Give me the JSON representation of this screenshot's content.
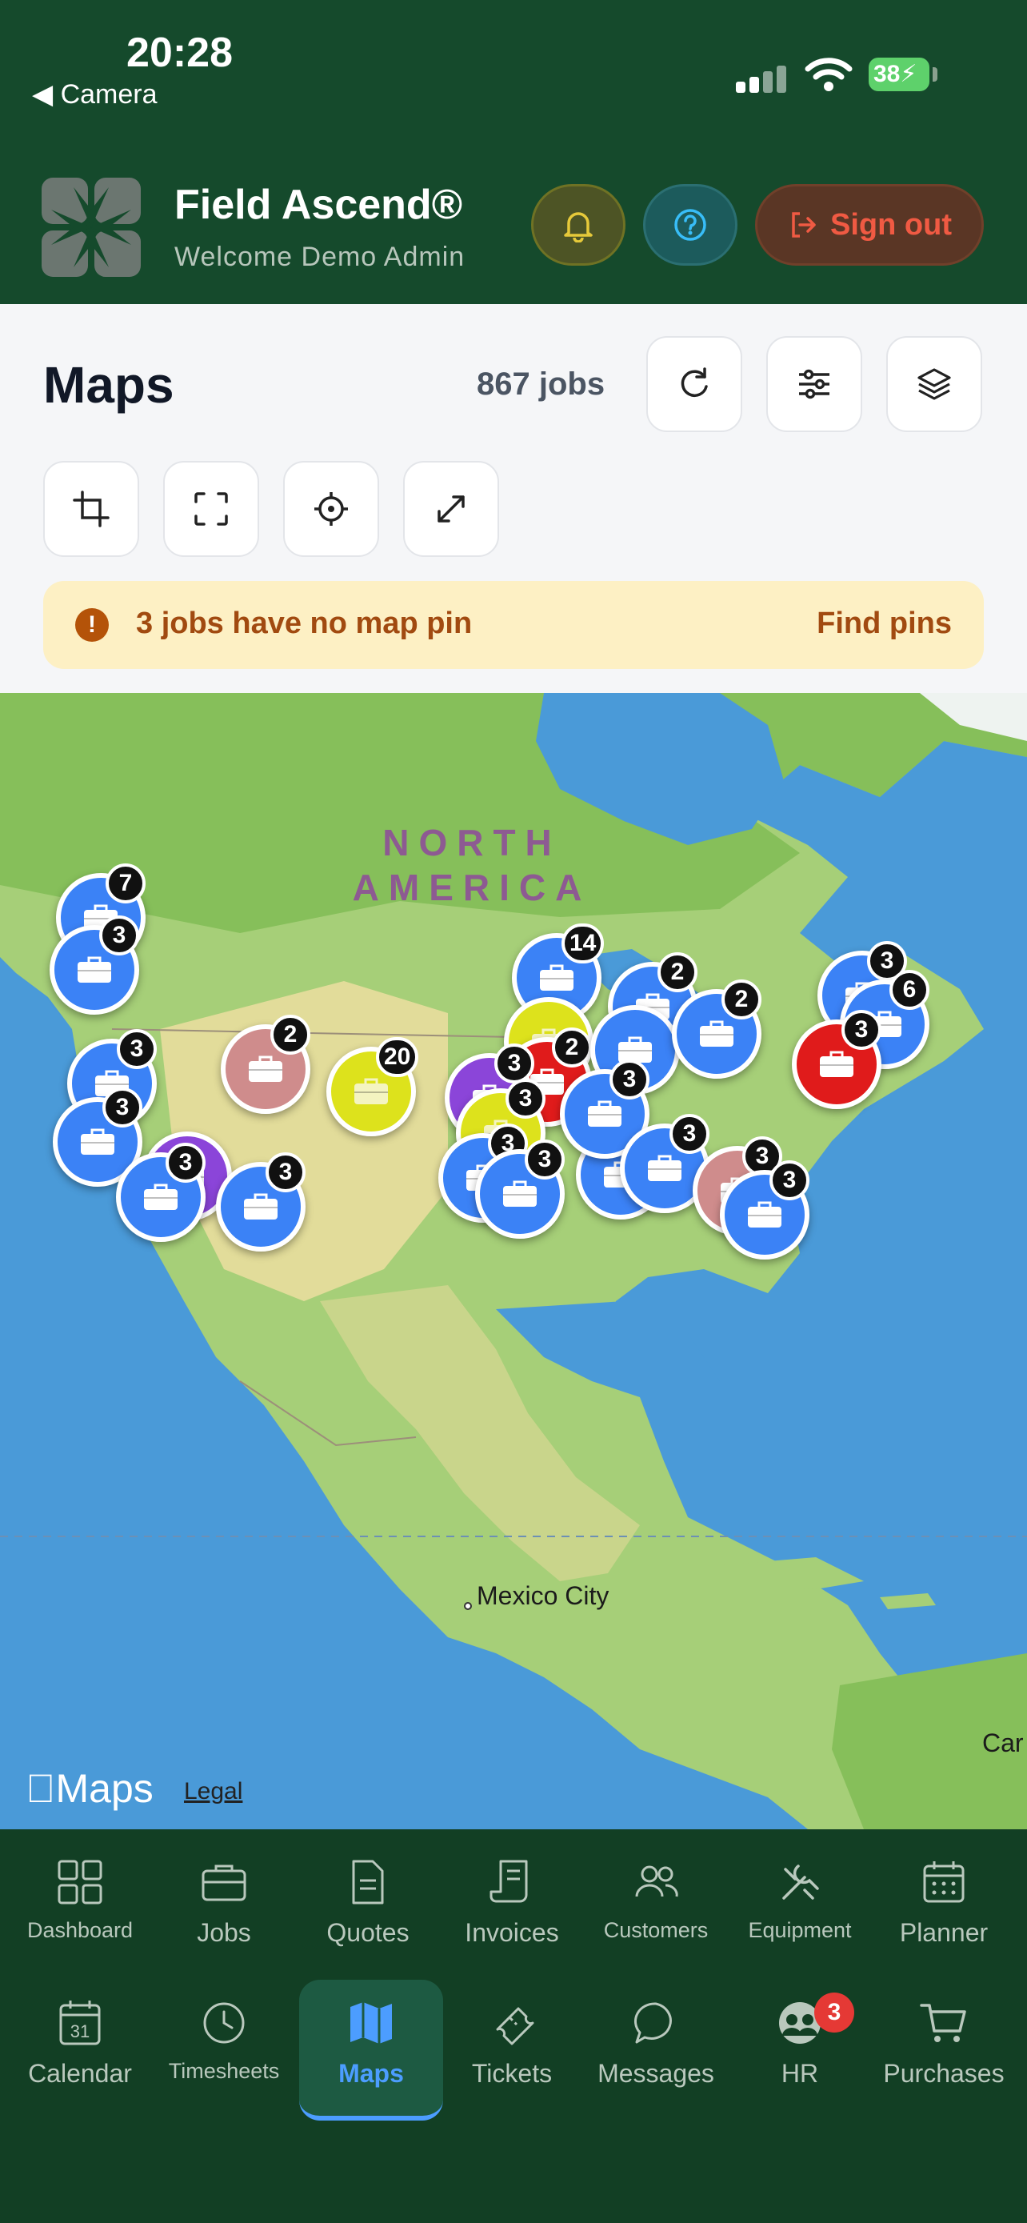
{
  "status_bar": {
    "time": "20:28",
    "back_label": "Camera",
    "battery": "38"
  },
  "app": {
    "title": "Field Ascend®",
    "subtitle": "Welcome Demo Admin",
    "sign_out": "Sign out"
  },
  "maps": {
    "title": "Maps",
    "jobs_count": "867 jobs",
    "alert_text": "3 jobs have no map pin",
    "alert_action": "Find pins"
  },
  "map": {
    "region_line1": "NORTH",
    "region_line2": "AMERICA",
    "city": "Mexico City",
    "city_partial": "Car",
    "attribution": "Maps",
    "legal": "Legal",
    "clusters": [
      {
        "color": "blue",
        "count": "7"
      },
      {
        "color": "blue",
        "count": "3"
      },
      {
        "color": "blue",
        "count": "3"
      },
      {
        "color": "blue",
        "count": "3"
      },
      {
        "color": "pink",
        "count": "2"
      },
      {
        "color": "yellow",
        "count": "20"
      },
      {
        "color": "purple",
        "count": ""
      },
      {
        "color": "blue",
        "count": "3"
      },
      {
        "color": "blue",
        "count": "3"
      },
      {
        "color": "blue",
        "count": "14"
      },
      {
        "color": "yellow",
        "count": ""
      },
      {
        "color": "red",
        "count": "2"
      },
      {
        "color": "purple",
        "count": "3"
      },
      {
        "color": "yellow",
        "count": "3"
      },
      {
        "color": "blue",
        "count": "3"
      },
      {
        "color": "blue",
        "count": ""
      },
      {
        "color": "blue",
        "count": "3"
      },
      {
        "color": "blue",
        "count": "2"
      },
      {
        "color": "blue",
        "count": ""
      },
      {
        "color": "blue",
        "count": "2"
      },
      {
        "color": "blue",
        "count": "3"
      },
      {
        "color": "blue",
        "count": "3"
      },
      {
        "color": "blue",
        "count": "3"
      },
      {
        "color": "blue",
        "count": "6"
      },
      {
        "color": "red",
        "count": "3"
      },
      {
        "color": "pink",
        "count": "3"
      },
      {
        "color": "blue",
        "count": "3"
      }
    ]
  },
  "nav": {
    "row1": [
      "Dashboard",
      "Jobs",
      "Quotes",
      "Invoices",
      "Customers",
      "Equipment",
      "Planner"
    ],
    "row2": [
      "Calendar",
      "Timesheets",
      "Maps",
      "Tickets",
      "Messages",
      "HR",
      "Purchases"
    ],
    "calendar_day": "31",
    "hr_badge": "3"
  },
  "colors": {
    "header_bg": "#154a2c",
    "nav_bg": "#123f24",
    "active_tab": "#4c9dff",
    "sign_out": "#f05a43",
    "alert_bg": "#fdf0c4"
  }
}
